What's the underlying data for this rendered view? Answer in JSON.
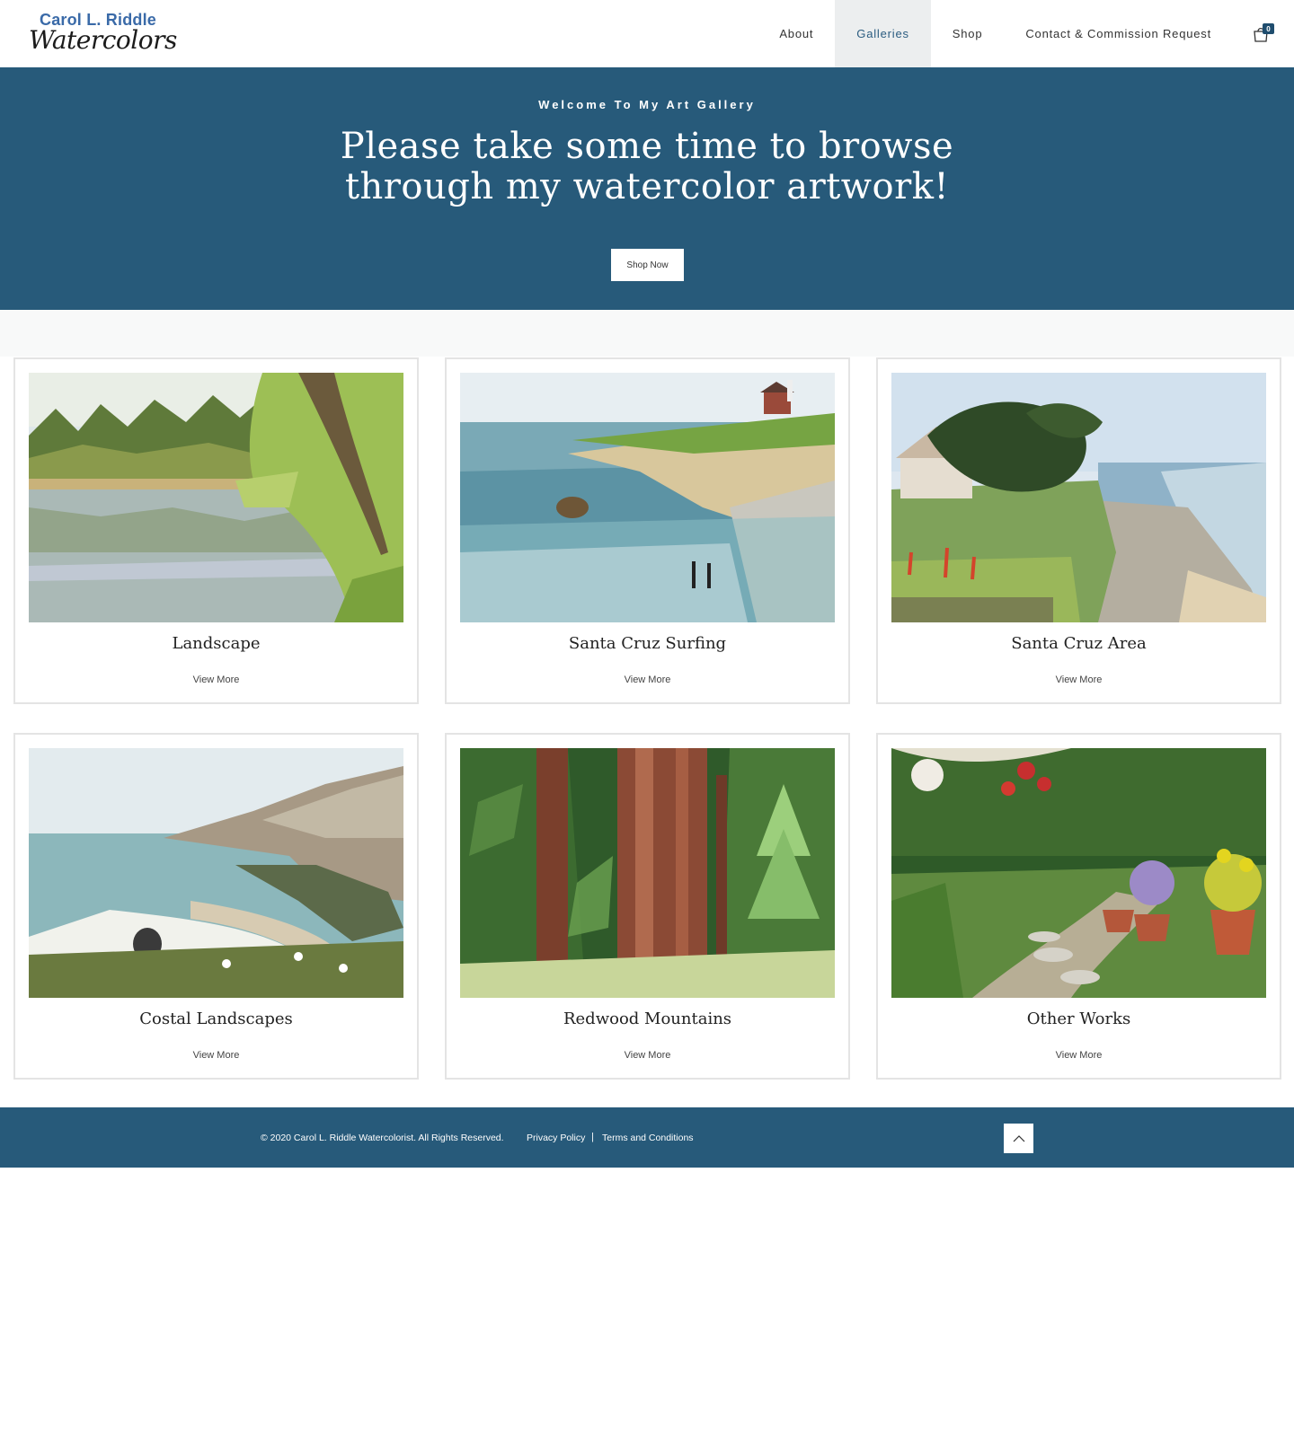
{
  "brand": {
    "name_line1": "Carol L. Riddle",
    "name_line2": "Watercolors"
  },
  "nav": {
    "items": [
      {
        "label": "About"
      },
      {
        "label": "Galleries"
      },
      {
        "label": "Shop"
      },
      {
        "label": "Contact & Commission Request"
      }
    ],
    "active_item": "Galleries",
    "cart_count": "0",
    "cart_icon": "shopping-bag-icon"
  },
  "hero": {
    "kicker": "Welcome To My Art Gallery",
    "title": "Please take some time to browse through my watercolor artwork!",
    "button_label": "Shop Now"
  },
  "galleries": [
    {
      "title": "Landscape",
      "link": "View More",
      "image": "watercolor-lake-landscape"
    },
    {
      "title": "Santa Cruz Surfing",
      "link": "View More",
      "image": "watercolor-cliff-surfers"
    },
    {
      "title": "Santa Cruz Area",
      "link": "View More",
      "image": "watercolor-coastal-house"
    },
    {
      "title": "Costal Landscapes",
      "link": "View More",
      "image": "watercolor-coastline-cove"
    },
    {
      "title": "Redwood Mountains",
      "link": "View More",
      "image": "watercolor-redwood-forest"
    },
    {
      "title": "Other Works",
      "link": "View More",
      "image": "watercolor-garden-path"
    }
  ],
  "footer": {
    "copyright": "© 2020 Carol L. Riddle Watercolorist. All Rights Reserved.",
    "privacy": "Privacy Policy",
    "separator": "|",
    "terms": "Terms and Conditions",
    "back_to_top_icon": "chevron-up-icon"
  },
  "colors": {
    "brand_blue": "#275a7a",
    "logo_blue": "#3a6aa8",
    "nav_active_bg": "#eceeef",
    "card_border": "#e4e4e4"
  }
}
